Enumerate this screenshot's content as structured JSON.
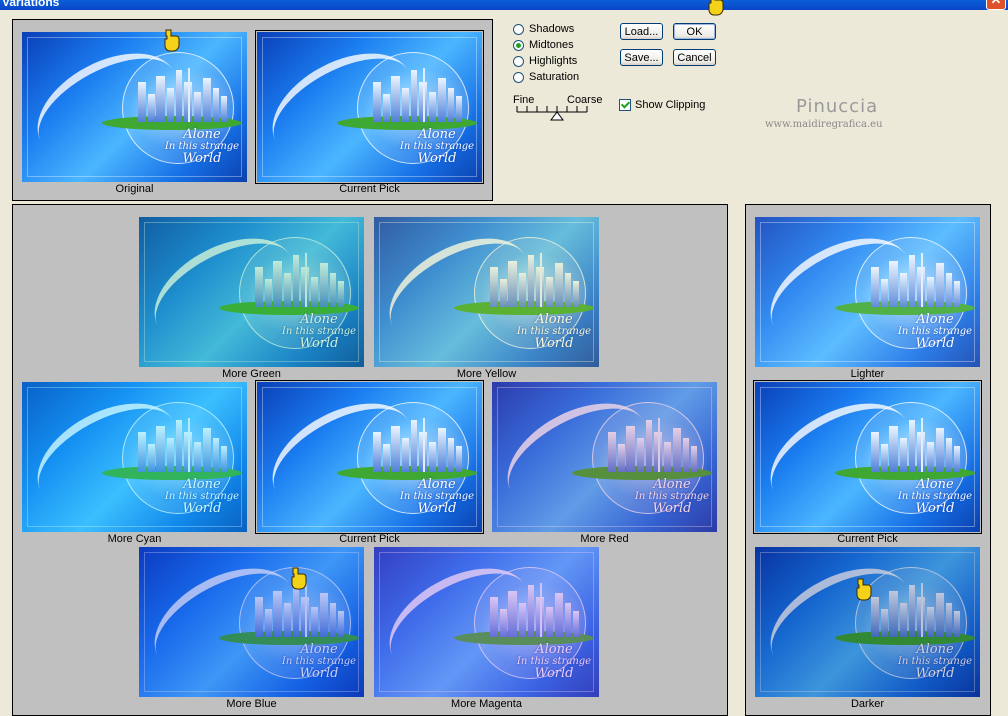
{
  "window": {
    "title": "Variations",
    "close_glyph": "✕"
  },
  "tone_options": [
    {
      "label": "Shadows",
      "selected": false
    },
    {
      "label": "Midtones",
      "selected": true
    },
    {
      "label": "Highlights",
      "selected": false
    },
    {
      "label": "Saturation",
      "selected": false
    }
  ],
  "buttons": {
    "load": "Load...",
    "ok": "OK",
    "save": "Save...",
    "cancel": "Cancel"
  },
  "slider": {
    "fine": "Fine",
    "coarse": "Coarse",
    "value_ticks_from_fine": 4,
    "total_ticks": 8
  },
  "show_clipping": {
    "label": "Show Clipping",
    "checked": true
  },
  "watermark": {
    "name": "Pinuccia",
    "url": "www.maidiregrafica.eu"
  },
  "image_text": [
    "Alone",
    "In this strange",
    "World"
  ],
  "compare": [
    {
      "caption": "Original",
      "selected": false
    },
    {
      "caption": "Current Pick",
      "selected": true
    }
  ],
  "colors": [
    {
      "caption": "More Green",
      "selected": false,
      "tint": "rgba(40,200,80,0.22)"
    },
    {
      "caption": "More Yellow",
      "selected": false,
      "tint": "rgba(230,220,60,0.18)"
    },
    {
      "caption": "More Cyan",
      "selected": false,
      "tint": "rgba(0,230,255,0.20)"
    },
    {
      "caption": "Current Pick",
      "selected": true,
      "tint": "rgba(0,0,0,0)"
    },
    {
      "caption": "More Red",
      "selected": false,
      "tint": "rgba(200,40,120,0.18)"
    },
    {
      "caption": "More Blue",
      "selected": false,
      "tint": "rgba(20,40,220,0.22)"
    },
    {
      "caption": "More Magenta",
      "selected": false,
      "tint": "rgba(170,60,220,0.25)"
    }
  ],
  "brightness": [
    {
      "caption": "Lighter",
      "selected": false,
      "tint": "rgba(255,255,255,0.10)"
    },
    {
      "caption": "Current Pick",
      "selected": true,
      "tint": "rgba(0,0,0,0)"
    },
    {
      "caption": "Darker",
      "selected": false,
      "tint": "rgba(0,0,60,0.18)"
    }
  ]
}
